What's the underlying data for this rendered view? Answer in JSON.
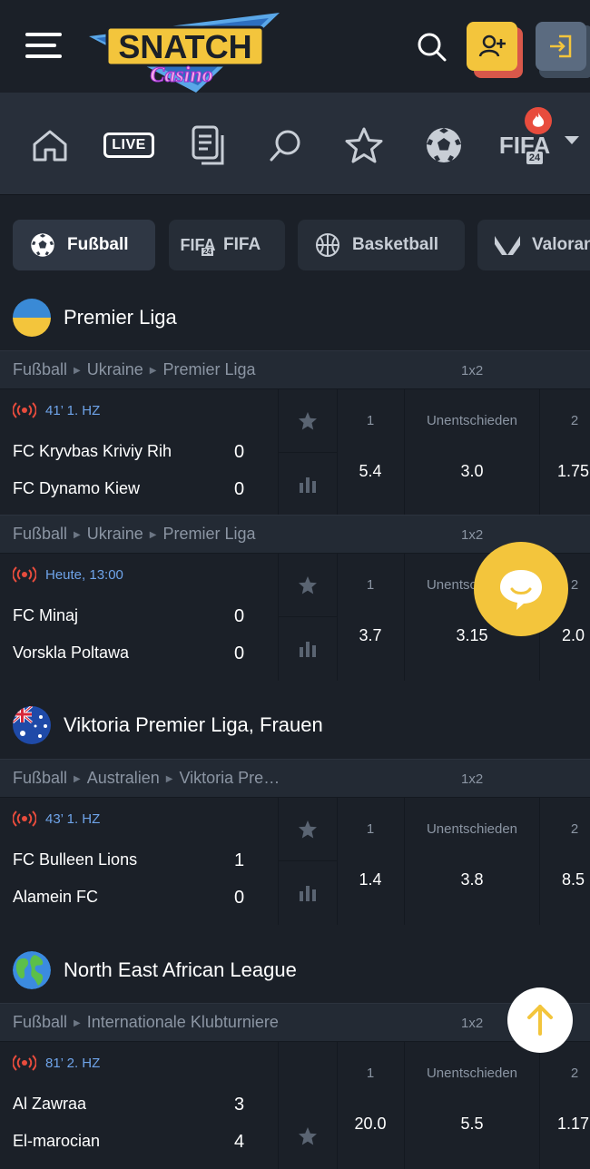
{
  "header": {
    "logo": {
      "line1": "SNATCH",
      "line2": "Casino"
    },
    "icons": {
      "menu": "hamburger-menu-icon",
      "search": "search-icon",
      "register": "add-user-icon",
      "login": "login-icon"
    }
  },
  "nav": {
    "live_label": "LIVE",
    "fifa_label": "FIFA",
    "fifa_badge": "24",
    "icons": [
      "home-icon",
      "live-icon",
      "betslip-icon",
      "search-icon",
      "star-icon",
      "soccer-ball-icon",
      "fifa-icon",
      "chevron-down-icon"
    ]
  },
  "sport_tabs": [
    {
      "label": "Fußball",
      "icon": "soccer-ball-icon",
      "active": true
    },
    {
      "label": "FIFA",
      "icon": "fifa-icon",
      "active": false
    },
    {
      "label": "Basketball",
      "icon": "basketball-icon",
      "active": false
    },
    {
      "label": "Valorant",
      "icon": "valorant-icon",
      "active": false
    }
  ],
  "fifa_tab_badge": "24",
  "leagues": [
    {
      "name": "Premier Liga",
      "flag": "ukraine"
    },
    {
      "name": "Viktoria Premier Liga, Frauen",
      "flag": "australia"
    },
    {
      "name": "North East African League",
      "flag": "world"
    }
  ],
  "matches": [
    {
      "breadcrumb": [
        "Fußball",
        "Ukraine",
        "Premier Liga"
      ],
      "market": "1x2",
      "status": "41’ 1. HZ",
      "home": "FC Kryvbas Kriviy Rih",
      "home_score": "0",
      "away": "FC Dynamo Kiew",
      "away_score": "0",
      "odds": [
        {
          "label": "1",
          "value": "5.4"
        },
        {
          "label": "Unentschieden",
          "value": "3.0"
        },
        {
          "label": "2",
          "value": "1.75"
        }
      ]
    },
    {
      "breadcrumb": [
        "Fußball",
        "Ukraine",
        "Premier Liga"
      ],
      "market": "1x2",
      "status": "Heute, 13:00",
      "home": "FC Minaj",
      "home_score": "0",
      "away": "Vorskla Poltawa",
      "away_score": "0",
      "odds": [
        {
          "label": "1",
          "value": "3.7"
        },
        {
          "label": "Unentschieden",
          "value": "3.15"
        },
        {
          "label": "2",
          "value": "2.0"
        }
      ]
    },
    {
      "breadcrumb": [
        "Fußball",
        "Australien",
        "Viktoria Pre…"
      ],
      "market": "1x2",
      "status": "43’ 1. HZ",
      "home": "FC Bulleen Lions",
      "home_score": "1",
      "away": "Alamein FC",
      "away_score": "0",
      "odds": [
        {
          "label": "1",
          "value": "1.4"
        },
        {
          "label": "Unentschieden",
          "value": "3.8"
        },
        {
          "label": "2",
          "value": "8.5"
        }
      ]
    },
    {
      "breadcrumb": [
        "Fußball",
        "Internationale Klubturniere"
      ],
      "market": "1x2",
      "status": "81’ 2. HZ",
      "home": "Al Zawraa",
      "home_score": "3",
      "away": "El-marocian",
      "away_score": "4",
      "odds": [
        {
          "label": "1",
          "value": "20.0"
        },
        {
          "label": "Unentschieden",
          "value": "5.5"
        },
        {
          "label": "2",
          "value": "1.17"
        }
      ]
    }
  ],
  "floating": {
    "chat": "chat-icon",
    "scroll_top": "arrow-up-icon"
  },
  "colors": {
    "background": "#1b2028",
    "accent": "#f3c53c",
    "live_status": "#6fa4ea",
    "live_icon": "#e84c3d"
  }
}
